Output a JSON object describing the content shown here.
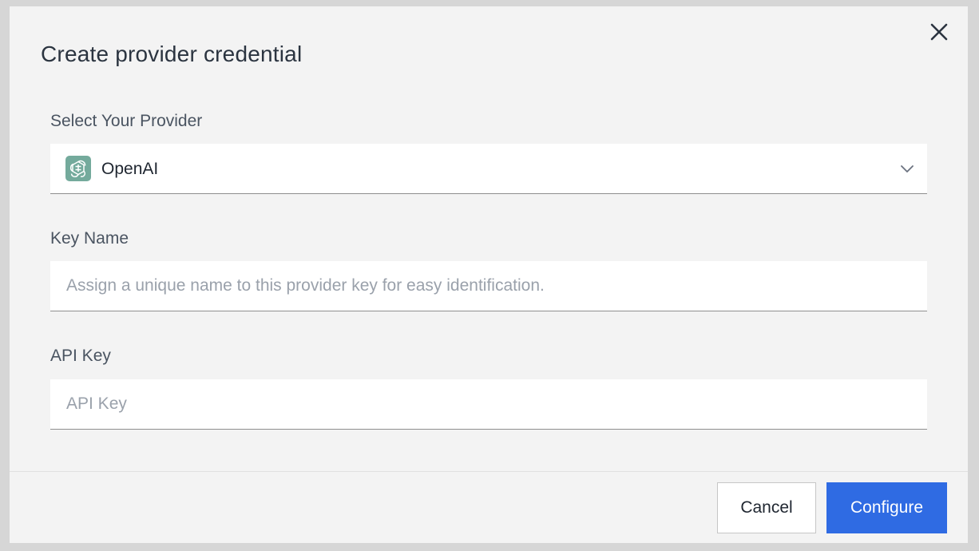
{
  "modal": {
    "title": "Create provider credential",
    "close_icon": "close-icon"
  },
  "provider": {
    "label": "Select Your Provider",
    "selected": "OpenAI",
    "logo_icon": "openai-logo-icon",
    "logo_color": "#74aa9c",
    "dropdown_icon": "chevron-down-icon"
  },
  "key_name": {
    "label": "Key Name",
    "value": "",
    "placeholder": "Assign a unique name to this provider key for easy identification."
  },
  "api_key": {
    "label": "API Key",
    "value": "",
    "placeholder": "API Key"
  },
  "footer": {
    "cancel_label": "Cancel",
    "configure_label": "Configure",
    "primary_color": "#2f6be3"
  }
}
